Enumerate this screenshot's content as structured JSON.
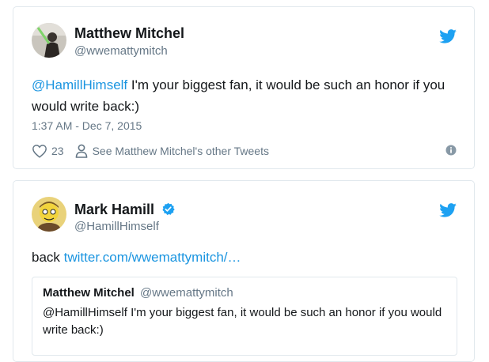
{
  "tweet1": {
    "author_name": "Matthew Mitchel",
    "author_handle": "@wwemattymitch",
    "mention": "@HamillHimself",
    "text_rest": " I'm your biggest fan, it would be such an honor if you would write back:)",
    "timestamp": "1:37 AM - Dec 7, 2015",
    "like_count": "23",
    "see_other_label": "See Matthew Mitchel's other Tweets",
    "icons": [
      "heart-icon",
      "person-icon",
      "info-icon",
      "twitter-bird-icon"
    ]
  },
  "tweet2": {
    "author_name": "Mark Hamill",
    "author_handle": "@HamillHimself",
    "text_prefix": "back ",
    "link_text": "twitter.com/wwemattymitch/…",
    "icons": [
      "verified-badge-icon",
      "twitter-bird-icon"
    ],
    "quote": {
      "author_name": "Matthew Mitchel",
      "author_handle": "@wwemattymitch",
      "text": "@HamillHimself I'm your biggest fan, it would be such an honor if you would write back:)"
    }
  },
  "colors": {
    "link": "#1b95e0",
    "secondary_text": "#657786",
    "border": "#e1e8ed"
  }
}
